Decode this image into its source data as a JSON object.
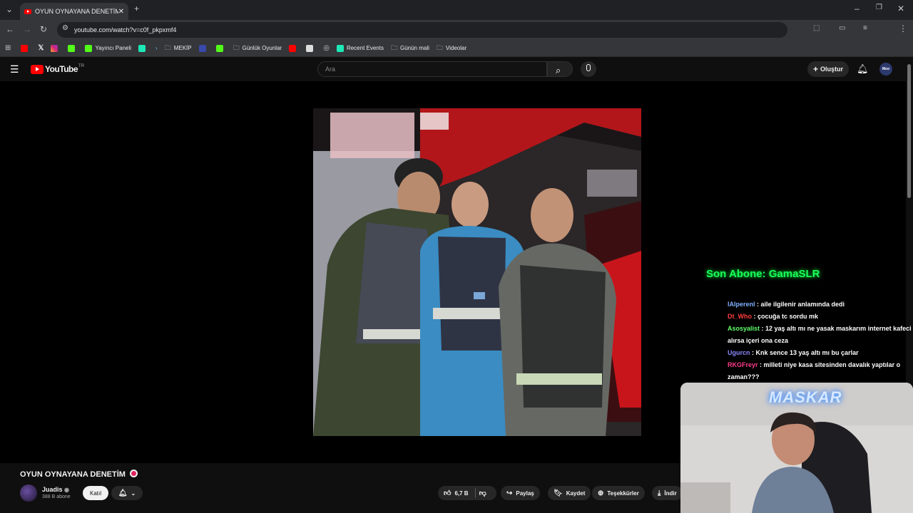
{
  "browser": {
    "tab_title": "OYUN OYNAYANA DENETİM",
    "url": "youtube.com/watch?v=c0f_pkpxmf4",
    "bookmarks": [
      "Yayıncı Paneli",
      "MEKİP",
      "Günlük Oyunlar",
      "Recent Events",
      "Günün mali",
      "Videolar"
    ]
  },
  "youtube": {
    "logo": "YouTube",
    "logo_region": "TR",
    "search_placeholder": "Ara",
    "create_label": "Oluştur",
    "avatar_text": "Moo"
  },
  "video": {
    "title": "OYUN OYNAYANA DENETİM",
    "channel": "Juadis",
    "subscribers": "388 B abone",
    "join_label": "Katıl",
    "likes": "6,7 B",
    "share_label": "Paylaş",
    "save_label": "Kaydet",
    "thanks_label": "Teşekkürler",
    "download_label": "İndir"
  },
  "overlay": {
    "last_subscriber": "Son Abone: GamaSLR",
    "webcam_logo": "MASKAR",
    "chat": [
      {
        "user": "lAlperenl",
        "color": "#7fb2ff",
        "message": "aile ilgilenir anlamında dedi"
      },
      {
        "user": "Dt_Who",
        "color": "#ff3c3c",
        "message": "çocuğa tc sordu mk"
      },
      {
        "user": "Asosyalist",
        "color": "#62ff6a",
        "message": "12 yaş altı mı ne yasak maskarım internet kafeci alırsa içeri ona ceza"
      },
      {
        "user": "Ugurcn",
        "color": "#8a8aff",
        "message": "Knk sence 13 yaş altı mı bu çarlar"
      },
      {
        "user": "RKGFreyr",
        "color": "#ff3c8a",
        "message": "milleti niye kasa sitesinden davalık yaptılar o zaman???"
      }
    ]
  },
  "colors": {
    "accent_red": "#ff0000",
    "page_bg": "#0f0f0f",
    "overlay_green": "#19ff5a"
  }
}
